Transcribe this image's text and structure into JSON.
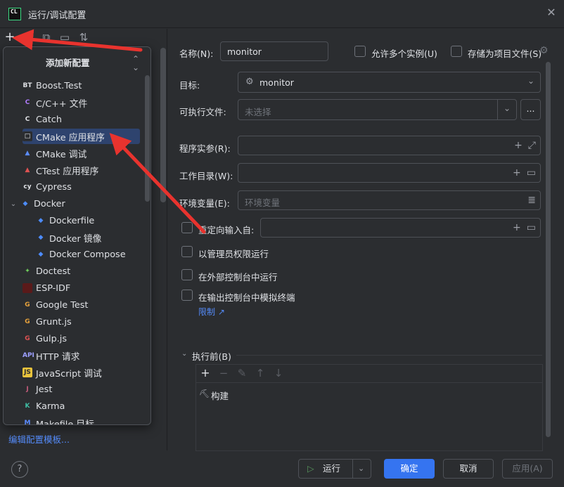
{
  "window": {
    "title": "运行/调试配置",
    "logo": "CL"
  },
  "left_toolbar": {
    "add_icon": "plus-icon",
    "copy_icon": "copy-icon",
    "folder_icon": "folder-icon",
    "sort_icon": "sort-icon"
  },
  "popup": {
    "title": "添加新配置",
    "items": [
      {
        "label": "Boost.Test",
        "icon": "BT",
        "color": "#2b2d30",
        "fg": "#dfe1e5"
      },
      {
        "label": "C/C++ 文件",
        "icon": "C",
        "color": "#2b2d30",
        "fg": "#b07cff"
      },
      {
        "label": "Catch",
        "icon": "C",
        "color": "#2b2d30",
        "fg": "#dfe1e5"
      },
      {
        "label": "CMake 应用程序",
        "icon": "□",
        "color": "#2b2d30",
        "fg": "#dfe1e5"
      },
      {
        "label": "CMake 调试",
        "icon": "▲",
        "color": "#2b2d30",
        "fg": "#5b8cff"
      },
      {
        "label": "CTest 应用程序",
        "icon": "▲",
        "color": "#2b2d30",
        "fg": "#e05252"
      },
      {
        "label": "Cypress",
        "icon": "cy",
        "color": "#2b2d30",
        "fg": "#dfe1e5"
      },
      {
        "label": "Docker",
        "icon": "◆",
        "color": "#2b2d30",
        "fg": "#4d8cff"
      },
      {
        "label": "Dockerfile",
        "icon": "◆",
        "color": "#2b2d30",
        "fg": "#4d8cff"
      },
      {
        "label": "Docker 镜像",
        "icon": "◆",
        "color": "#2b2d30",
        "fg": "#4d8cff"
      },
      {
        "label": "Docker Compose",
        "icon": "◆",
        "color": "#2b2d30",
        "fg": "#4d8cff"
      },
      {
        "label": "Doctest",
        "icon": "✦",
        "color": "#2b2d30",
        "fg": "#6fcf5c"
      },
      {
        "label": "ESP-IDF",
        "icon": "",
        "color": "#5a1a1a",
        "fg": "#ffffff"
      },
      {
        "label": "Google Test",
        "icon": "G",
        "color": "#2b2d30",
        "fg": "#e8a33c"
      },
      {
        "label": "Grunt.js",
        "icon": "G",
        "color": "#2b2d30",
        "fg": "#e8a33c"
      },
      {
        "label": "Gulp.js",
        "icon": "G",
        "color": "#2b2d30",
        "fg": "#e05252"
      },
      {
        "label": "HTTP 请求",
        "icon": "API",
        "color": "#2b2d30",
        "fg": "#9da0ff"
      },
      {
        "label": "JavaScript 调试",
        "icon": "JS",
        "color": "#e8c33c",
        "fg": "#2b2d30"
      },
      {
        "label": "Jest",
        "icon": "J",
        "color": "#2b2d30",
        "fg": "#c25b7a"
      },
      {
        "label": "Karma",
        "icon": "K",
        "color": "#2b2d30",
        "fg": "#3fbfa5"
      },
      {
        "label": "Makefile 目标",
        "icon": "M",
        "color": "#2b2d30",
        "fg": "#5b8cff"
      }
    ]
  },
  "edit_templates": "编辑配置模板...",
  "form": {
    "name_label": "名称(N):",
    "name_value": "monitor",
    "allow_multiple": "允许多个实例(U)",
    "store_as_project": "存储为项目文件(S)",
    "target_label": "目标:",
    "target_value": "monitor",
    "executable_label": "可执行文件:",
    "executable_placeholder": "未选择",
    "more_button": "...",
    "args_label": "程序实参(R):",
    "workdir_label": "工作目录(W):",
    "env_label": "环境变量(E):",
    "env_placeholder": "环境变量",
    "redirect_label": "重定向输入自:",
    "run_admin": "以管理员权限运行",
    "run_external": "在外部控制台中运行",
    "emulate_terminal": "在输出控制台中模拟终端",
    "limits_link": "限制 ↗",
    "before_launch": "执行前(B)",
    "before_items": [
      {
        "label": "构建",
        "icon": "hammer-icon"
      }
    ]
  },
  "buttons": {
    "run": "运行",
    "ok": "确定",
    "cancel": "取消",
    "apply": "应用(A)",
    "help": "?"
  },
  "colors": {
    "accent": "#3574f0",
    "arrow": "#e8332e",
    "selection": "#2e436e",
    "link": "#548af7"
  }
}
